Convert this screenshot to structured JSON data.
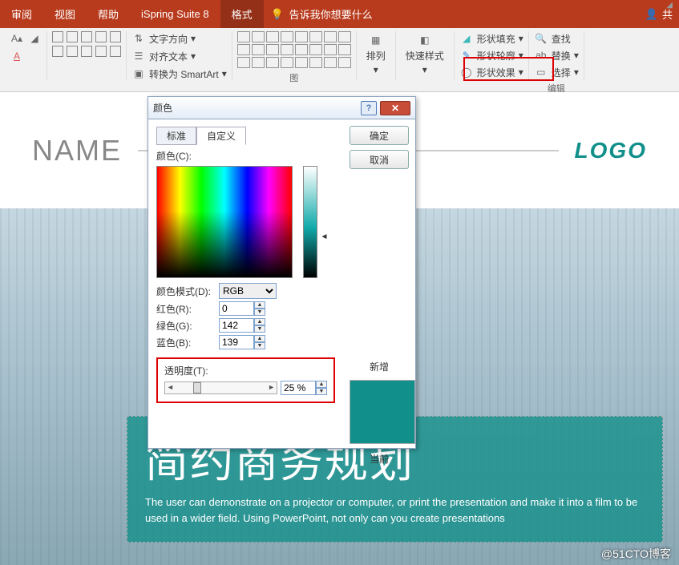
{
  "tabs": {
    "review": "审阅",
    "view": "视图",
    "help": "帮助",
    "ispring": "iSpring Suite 8",
    "format": "格式",
    "tellme": "告诉我你想要什么",
    "share": "共"
  },
  "ribbon": {
    "text_direction": "文字方向",
    "align_text": "对齐文本",
    "smartart": "转换为 SmartArt",
    "arrange": "排列",
    "quick_styles": "快速样式",
    "shape_fill": "形状填充",
    "shape_outline": "形状轮廓",
    "shape_effects": "形状效果",
    "find": "查找",
    "replace": "替换",
    "select": "选择",
    "edit_group": "编辑",
    "shapes_group": "图"
  },
  "slide": {
    "name": "NAME",
    "logo": "LOGO",
    "title": "简约商务规划",
    "subtitle": "The user can demonstrate on a projector or computer, or print the presentation and make it into a film to be used in a wider field. Using PowerPoint, not only can you create presentations",
    "watermark": "@51CTO博客"
  },
  "dialog": {
    "title": "颜色",
    "ok": "确定",
    "cancel": "取消",
    "tab_standard": "标准",
    "tab_custom": "自定义",
    "color_label": "颜色(C):",
    "mode_label": "颜色模式(D):",
    "mode_value": "RGB",
    "r_label": "红色(R):",
    "r": "0",
    "g_label": "绿色(G):",
    "g": "142",
    "b_label": "蓝色(B):",
    "b": "139",
    "new": "新增",
    "current": "当前",
    "transparency_label": "透明度(T):",
    "transparency_value": "25 %"
  }
}
